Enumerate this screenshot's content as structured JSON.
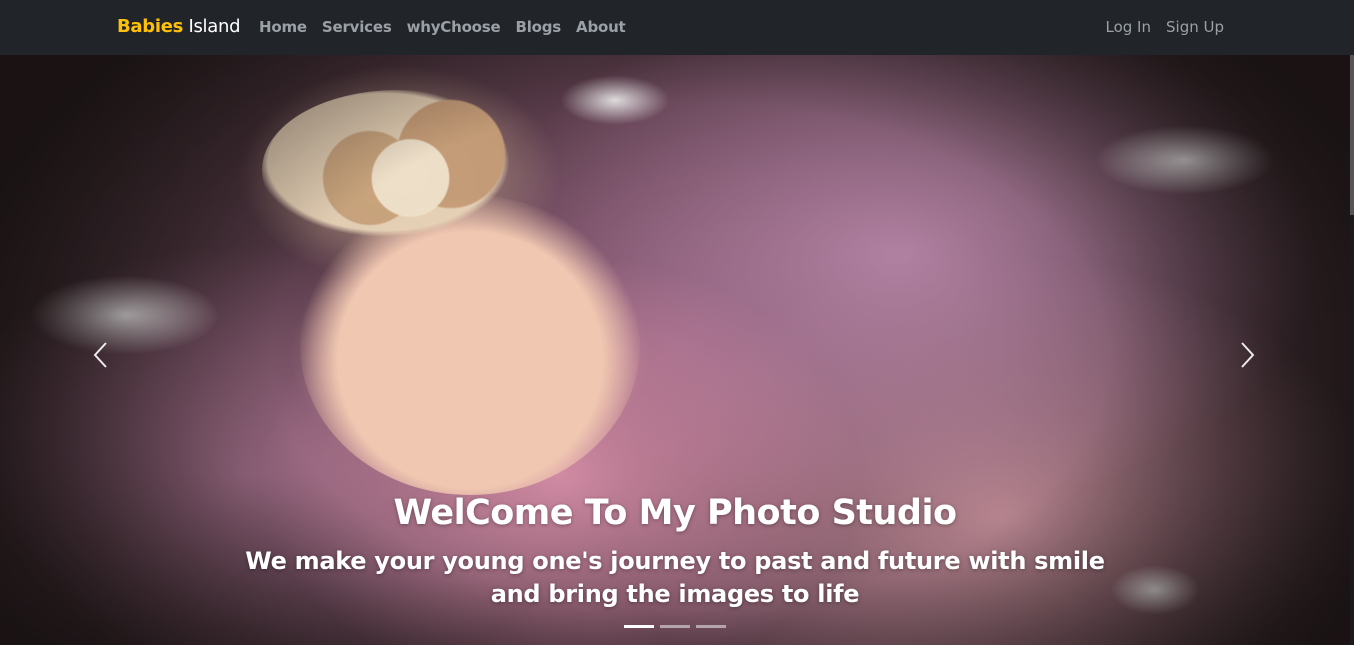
{
  "navbar": {
    "brand_part1": "Babies",
    "brand_part2": "Island",
    "links": [
      "Home",
      "Services",
      "whyChoose",
      "Blogs",
      "About"
    ],
    "login": "Log In",
    "signup": "Sign Up",
    "colors": {
      "background": "#212529",
      "brand_accent": "#ffc107",
      "link": "#9aa0a6"
    }
  },
  "carousel": {
    "title": "WelCome To My Photo Studio",
    "subtitle": "We make your young one's journey to past and future with smile and bring the images to life",
    "indicator_count": 3,
    "active_index": 0,
    "prev_icon": "chevron-left-icon",
    "next_icon": "chevron-right-icon"
  }
}
